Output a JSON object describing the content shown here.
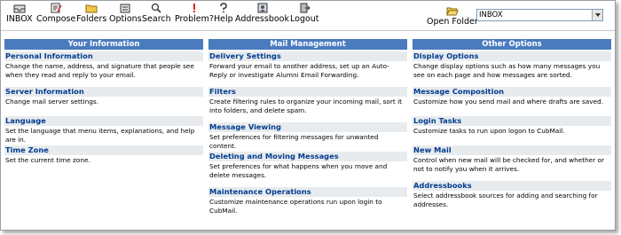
{
  "toolbar": {
    "items": [
      {
        "label": "INBOX",
        "icon": "inbox-icon"
      },
      {
        "label": "Compose",
        "icon": "compose-icon"
      },
      {
        "label": "Folders",
        "icon": "folders-icon"
      },
      {
        "label": "Options",
        "icon": "options-icon"
      },
      {
        "label": "Search",
        "icon": "search-icon"
      },
      {
        "label": "Problem?",
        "icon": "problem-icon"
      },
      {
        "label": "Help",
        "icon": "help-icon"
      },
      {
        "label": "Addressbook",
        "icon": "addressbook-icon"
      },
      {
        "label": "Logout",
        "icon": "logout-icon"
      }
    ],
    "open_folder_label": "Open Folder",
    "folder_select_value": "INBOX"
  },
  "columns": [
    {
      "title": "Your Information",
      "sections": [
        {
          "title": "Personal Information",
          "desc": "Change the name, address, and signature that people see when they read and reply to your email."
        },
        {
          "title": "Server Information",
          "desc": "Change mail server settings."
        },
        {
          "title": "Language",
          "desc": "Set the language that menu items, explanations, and help are in."
        },
        {
          "title": "Time Zone",
          "desc": "Set the current time zone."
        }
      ]
    },
    {
      "title": "Mail Management",
      "sections": [
        {
          "title": "Delivery Settings",
          "desc": "Forward your email to another address, set up an Auto-Reply or investigate Alumni Email Forwarding."
        },
        {
          "title": "Filters",
          "desc": "Create filtering rules to organize your incoming mail, sort it into folders, and delete spam."
        },
        {
          "title": "Message Viewing",
          "desc": "Set preferences for filtering messages for unwanted content."
        },
        {
          "title": "Deleting and Moving Messages",
          "desc": "Set preferences for what happens when you move and delete messages."
        },
        {
          "title": "Maintenance Operations",
          "desc": "Customize maintenance operations run upon login to CubMail."
        }
      ]
    },
    {
      "title": "Other Options",
      "sections": [
        {
          "title": "Display Options",
          "desc": "Change display options such as how many messages you see on each page and how messages are sorted."
        },
        {
          "title": "Message Composition",
          "desc": "Customize how you send mail and where drafts are saved."
        },
        {
          "title": "Login Tasks",
          "desc": "Customize tasks to run upon logon to CubMail."
        },
        {
          "title": "New Mail",
          "desc": "Control when new mail will be checked for, and whether or not to notify you when it arrives."
        },
        {
          "title": "Addressbooks",
          "desc": "Select addressbook sources for adding and searching for addresses."
        }
      ]
    }
  ],
  "colors": {
    "header_bg": "#4a7bbf",
    "section_bg": "#e8ebee",
    "link": "#003d8f"
  }
}
